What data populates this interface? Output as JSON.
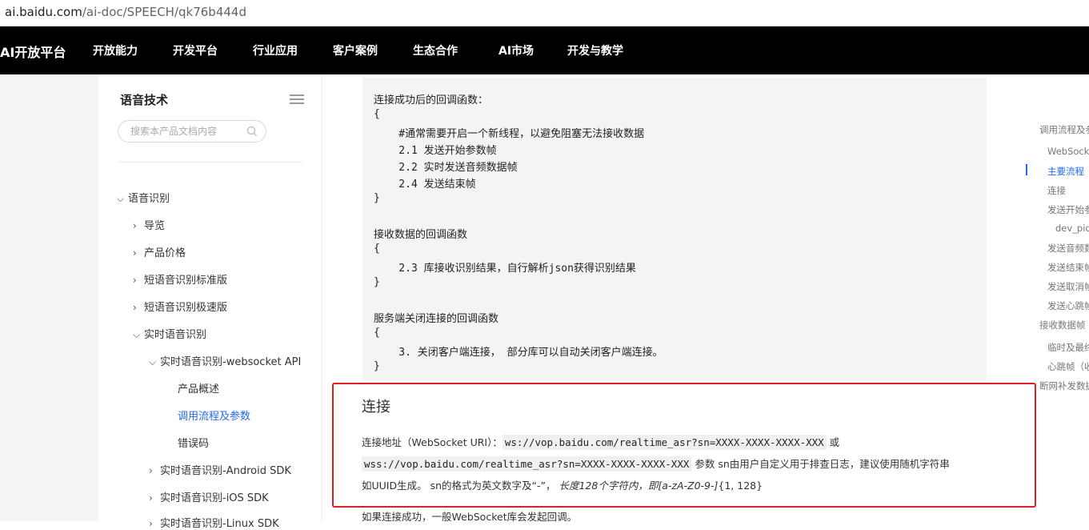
{
  "browser": {
    "url_host": "ai.baidu.com",
    "url_path": "/ai-doc/SPEECH/qk76b444d"
  },
  "nav": {
    "logo": "AI开放平台",
    "items": [
      "开放能力",
      "开发平台",
      "行业应用",
      "客户案例",
      "生态合作",
      "AI市场",
      "开发与教学"
    ]
  },
  "sidebar": {
    "title": "语音技术",
    "search_placeholder": "搜索本产品文档内容",
    "items": [
      {
        "label": "语音识别",
        "chevron": "⌵"
      },
      {
        "label": "导览",
        "chevron": "›"
      },
      {
        "label": "产品价格",
        "chevron": "›"
      },
      {
        "label": "短语音识别标准版",
        "chevron": "›"
      },
      {
        "label": "短语音识别极速版",
        "chevron": "›"
      },
      {
        "label": "实时语音识别",
        "chevron": "⌵"
      },
      {
        "label": "实时语音识别-websocket API",
        "chevron": "⌵"
      },
      {
        "label": "产品概述",
        "chevron": ""
      },
      {
        "label": "调用流程及参数",
        "chevron": ""
      },
      {
        "label": "错误码",
        "chevron": ""
      },
      {
        "label": "实时语音识别-Android SDK",
        "chevron": "›"
      },
      {
        "label": "实时语音识别-iOS SDK",
        "chevron": "›"
      },
      {
        "label": "实时语音识别-Linux SDK",
        "chevron": "›"
      }
    ]
  },
  "code": {
    "lines": [
      "连接成功后的回调函数：",
      "{",
      "    #通常需要开启一个新线程，以避免阻塞无法接收数据",
      "    2.1 发送开始参数帧",
      "    2.2 实时发送音频数据帧",
      "    2.4 发送结束帧",
      "}",
      "",
      "接收数据的回调函数",
      "{",
      "    2.3 库接收识别结果，自行解析json获得识别结果",
      "}",
      "",
      "服务端关闭连接的回调函数",
      "{",
      "    3. 关闭客户端连接， 部分库可以自动关闭客户端连接。",
      "}"
    ]
  },
  "section": {
    "heading": "连接",
    "p1_prefix": "连接地址（WebSocket URI）：",
    "ws_uri": "ws://vop.baidu.com/realtime_asr?sn=XXXX-XXXX-XXXX-XXX",
    "or": " 或",
    "wss_uri": "wss://vop.baidu.com/realtime_asr?sn=XXXX-XXXX-XXXX-XXX",
    "p2_suffix": " 参数 sn由用户自定义用于排查日志，建议使用随机字符串",
    "p3_a": "如UUID生成。 sn的格式为英文数字及“-”，",
    "p3_b": "长度128个字符内，即[a-zA-Z0-9-]",
    "p3_c": "{1, 128}",
    "p4": "如果连接成功，一般WebSocket库会发起回调。"
  },
  "toc": {
    "items": [
      {
        "label": "调用流程及参"
      },
      {
        "label": "WebSocket"
      },
      {
        "label": "主要流程",
        "active": true
      },
      {
        "label": "连接"
      },
      {
        "label": "发送开始参"
      },
      {
        "label": "dev_pid"
      },
      {
        "label": "发送音频数"
      },
      {
        "label": "发送结束帧"
      },
      {
        "label": "发送取消帧"
      },
      {
        "label": "发送心跳帧"
      },
      {
        "label": "接收数据帧"
      },
      {
        "label": "临时及最终"
      },
      {
        "label": "心跳帧（收"
      },
      {
        "label": "断网补发数据"
      }
    ]
  },
  "colors": {
    "accent": "#2468f2",
    "highlight_box": "#e02020",
    "nav_bg": "#000000"
  }
}
